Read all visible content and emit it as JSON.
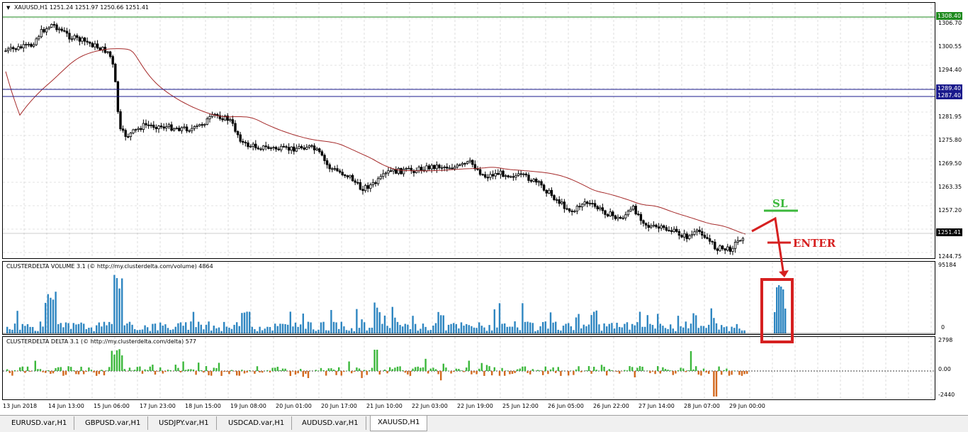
{
  "chart": {
    "symbol_title": "XAUUSD,H1",
    "ohlc": "1251.24 1251.97 1250.66 1251.41",
    "price_ticks": [
      "1306.70",
      "1300.55",
      "1294.40",
      "1281.95",
      "1275.80",
      "1269.50",
      "1263.35",
      "1257.20",
      "1244.75"
    ],
    "price_tags": [
      {
        "label": "1308.40",
        "color": "#1e8a1e"
      },
      {
        "label": "1289.40",
        "color": "#1a1a8c"
      },
      {
        "label": "1287.40",
        "color": "#1a1a8c"
      },
      {
        "label": "1251.41",
        "color": "#000000"
      }
    ],
    "time_labels": [
      "13 Jun 2018",
      "14 Jun 13:00",
      "15 Jun 06:00",
      "17 Jun 23:00",
      "18 Jun 15:00",
      "19 Jun 08:00",
      "20 Jun 01:00",
      "20 Jun 17:00",
      "21 Jun 10:00",
      "22 Jun 03:00",
      "22 Jun 19:00",
      "25 Jun 12:00",
      "26 Jun 05:00",
      "26 Jun 22:00",
      "27 Jun 14:00",
      "28 Jun 07:00",
      "29 Jun 00:00"
    ]
  },
  "volume_panel": {
    "title": "CLUSTERDELTA VOLUME 3.1 (© http://my.clusterdelta.com/volume) 4864",
    "max_label": "95184",
    "zero_label": "0"
  },
  "delta_panel": {
    "title": "CLUSTERDELTA DELTA 3.1 (© http://my.clusterdelta.com/delta) 577",
    "top_label": "2798",
    "mid_label": "0.00",
    "bottom_label": "-2440"
  },
  "annotations": {
    "sl_label": "SL",
    "enter_label": "ENTER",
    "sl_color": "#3cb83c",
    "enter_color": "#d62020"
  },
  "tabs": [
    {
      "label": "EURUSD.var,H1",
      "active": false
    },
    {
      "label": "GBPUSD.var,H1",
      "active": false
    },
    {
      "label": "USDJPY.var,H1",
      "active": false
    },
    {
      "label": "USDCAD.var,H1",
      "active": false
    },
    {
      "label": "AUDUSD.var,H1",
      "active": false
    },
    {
      "label": "XAUUSD,H1",
      "active": true
    }
  ],
  "colors": {
    "grid": "#c8c8c8",
    "candle": "#000000",
    "ma": "#a52a2a",
    "volume_bar": "#2e86c1",
    "delta_pos": "#3cb83c",
    "delta_neg": "#d2691e",
    "level_green": "#1e8a1e",
    "level_blue": "#1a1a8c"
  }
}
